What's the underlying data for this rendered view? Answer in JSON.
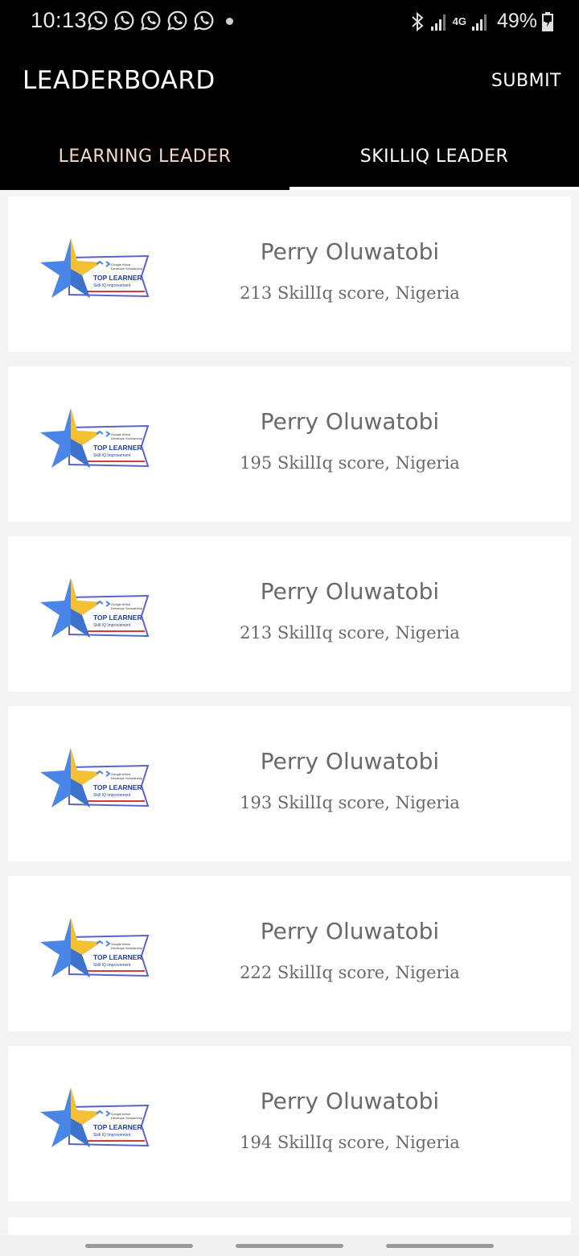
{
  "status_bar": {
    "time": "10:13",
    "notification_icons": [
      "whatsapp-icon",
      "whatsapp-icon",
      "whatsapp-icon",
      "whatsapp-icon",
      "whatsapp-icon"
    ],
    "network": "4G",
    "battery": "49%"
  },
  "app_bar": {
    "title": "LEADERBOARD",
    "submit_label": "SUBMIT"
  },
  "tabs": [
    {
      "label": "LEARNING LEADER",
      "selected": false
    },
    {
      "label": "SKILLIQ LEADER",
      "selected": true
    }
  ],
  "badge": {
    "caption": "TOP LEARNER",
    "subcaption": "Skill IQ Improvement",
    "brand_line1": "Google Africa",
    "brand_line2": "Develope Scholarship",
    "star_color": "#4a86e8",
    "star_accent": "#f4c034"
  },
  "leaders": [
    {
      "name": "Perry Oluwatobi",
      "detail": "213 SkillIq score, Nigeria"
    },
    {
      "name": "Perry Oluwatobi",
      "detail": "195 SkillIq score, Nigeria"
    },
    {
      "name": "Perry Oluwatobi",
      "detail": "213 SkillIq score, Nigeria"
    },
    {
      "name": "Perry Oluwatobi",
      "detail": "193 SkillIq score, Nigeria"
    },
    {
      "name": "Perry Oluwatobi",
      "detail": "222 SkillIq score, Nigeria"
    },
    {
      "name": "Perry Oluwatobi",
      "detail": "194 SkillIq score, Nigeria"
    }
  ],
  "colors": {
    "app_bar": "#000000",
    "tab_indicator": "#ffffff",
    "text_gray": "#6a6a6a"
  }
}
